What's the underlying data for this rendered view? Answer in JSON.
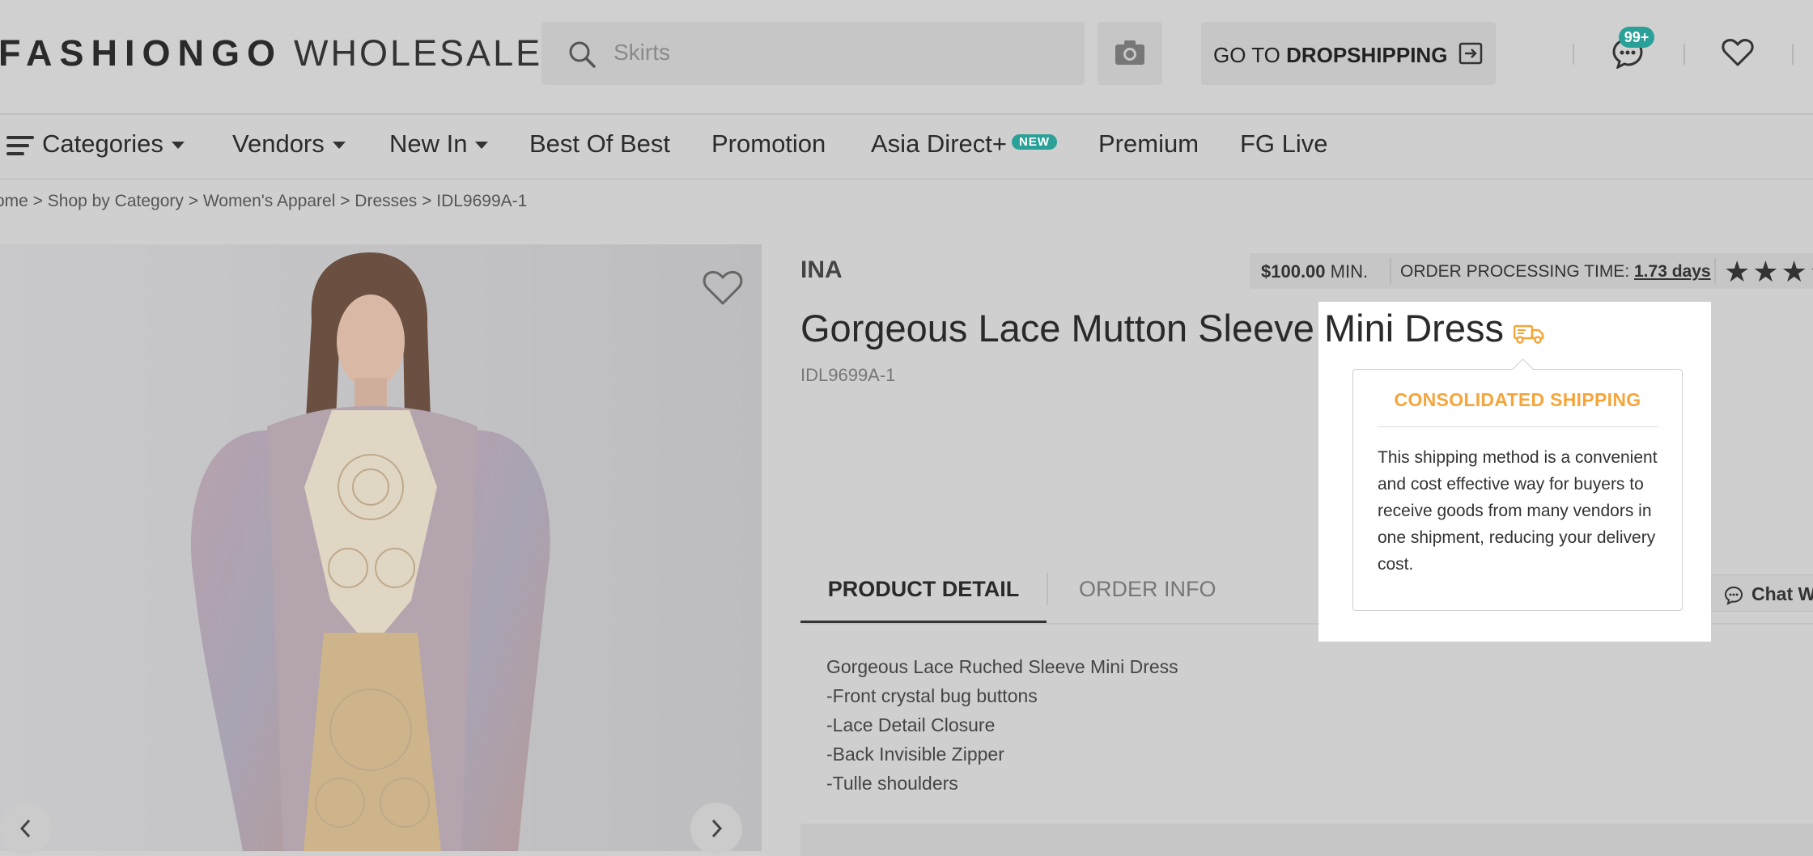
{
  "header": {
    "logo_main": "FASHIONGO",
    "logo_sub": "WHOLESALE",
    "search_placeholder": "Skirts",
    "dropship_prefix": "GO TO ",
    "dropship_bold": "DROPSHIPPING",
    "message_badge": "99+"
  },
  "nav": {
    "items": [
      {
        "label": "Categories"
      },
      {
        "label": "Vendors"
      },
      {
        "label": "New In"
      },
      {
        "label": "Best Of Best"
      },
      {
        "label": "Promotion"
      },
      {
        "label": "Asia Direct+"
      },
      {
        "label": "Premium"
      },
      {
        "label": "FG Live"
      }
    ],
    "new_badge": "NEW"
  },
  "breadcrumb": "ome > Shop by Category > Women's Apparel > Dresses > IDL9699A-1",
  "product": {
    "vendor": "INA",
    "min_amount": "$100.00",
    "min_label": " MIN.",
    "processing_label": "ORDER PROCESSING TIME: ",
    "processing_value": "1.73 days",
    "stars": "★★★★",
    "title_part1": "Gorgeous Lace Mutton Sleeve ",
    "title_part2": "Mini Dress",
    "sku": "IDL9699A-1"
  },
  "tabs": {
    "detail": "PRODUCT DETAIL",
    "order": "ORDER INFO",
    "chat": "Chat W"
  },
  "description": [
    "Gorgeous Lace Ruched Sleeve Mini Dress",
    "-Front crystal bug buttons",
    "-Lace Detail Closure",
    "-Back Invisible Zipper",
    "-Tulle shoulders"
  ],
  "tooltip": {
    "heading": "CONSOLIDATED SHIPPING",
    "body": "This shipping method is a convenient and cost effective way for buyers to receive goods from many vendors in one shipment, reducing your delivery cost."
  },
  "colors": {
    "accent_teal": "#2aa198",
    "shipping_orange": "#f5a53a"
  }
}
